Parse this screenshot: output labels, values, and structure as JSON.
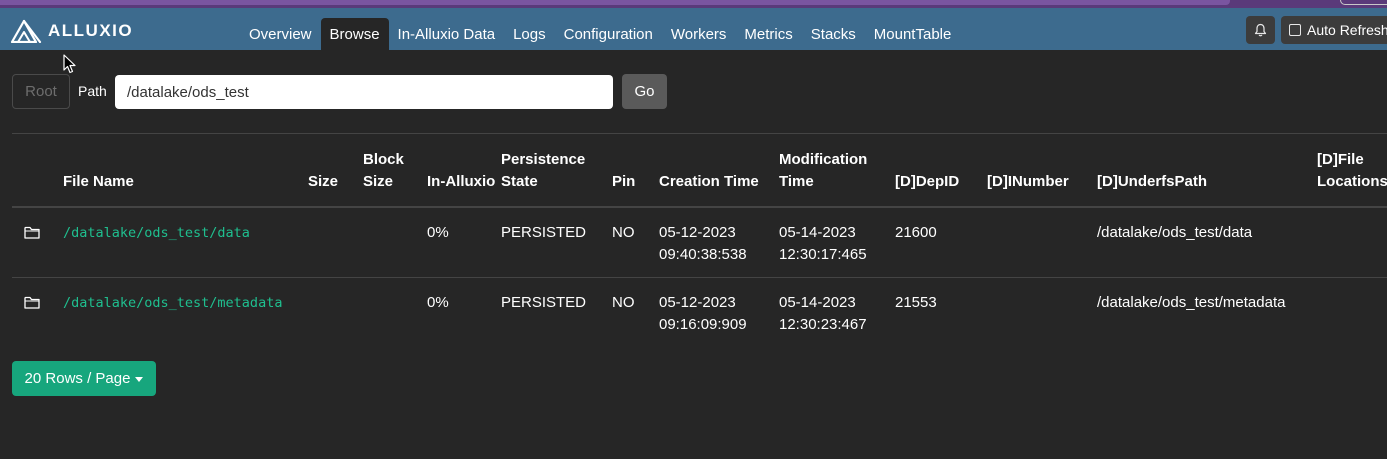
{
  "app": {
    "brand": "ALLUXIO"
  },
  "nav": {
    "links": [
      "Overview",
      "Browse",
      "In-Alluxio Data",
      "Logs",
      "Configuration",
      "Workers",
      "Metrics",
      "Stacks",
      "MountTable"
    ],
    "active": "Browse",
    "auto_refresh_label": "Auto Refresh",
    "auto_refresh_checked": false
  },
  "browse": {
    "root_button": "Root",
    "path_label": "Path",
    "path_value": "/datalake/ods_test",
    "go_button": "Go"
  },
  "table": {
    "columns": [
      "",
      "File Name",
      "Size",
      "Block Size",
      "In-Alluxio",
      "Persistence State",
      "Pin",
      "Creation Time",
      "Modification Time",
      "[D]DepID",
      "[D]INumber",
      "[D]UnderfsPath",
      "[D]File Locations"
    ],
    "rows": [
      {
        "icon": "folder-icon",
        "file_name": "/datalake/ods_test/data",
        "size": "",
        "block_size": "",
        "in_alluxio": "0%",
        "persistence_state": "PERSISTED",
        "pin": "NO",
        "creation_date": "05-12-2023",
        "creation_time": "09:40:38:538",
        "modification_date": "05-14-2023",
        "modification_time": "12:30:17:465",
        "dep_id": "21600",
        "inumber": "",
        "underfs_path": "/datalake/ods_test/data",
        "file_locations": ""
      },
      {
        "icon": "folder-icon",
        "file_name": "/datalake/ods_test/metadata",
        "size": "",
        "block_size": "",
        "in_alluxio": "0%",
        "persistence_state": "PERSISTED",
        "pin": "NO",
        "creation_date": "05-12-2023",
        "creation_time": "09:16:09:909",
        "modification_date": "05-14-2023",
        "modification_time": "12:30:23:467",
        "dep_id": "21553",
        "inumber": "",
        "underfs_path": "/datalake/ods_test/metadata",
        "file_locations": ""
      }
    ]
  },
  "pagination": {
    "rows_per_page_label": "20 Rows / Page"
  },
  "colors": {
    "navbar": "#3d6b8e",
    "background": "#262626",
    "link": "#1fbf8f",
    "primary_button": "#17a67d"
  }
}
